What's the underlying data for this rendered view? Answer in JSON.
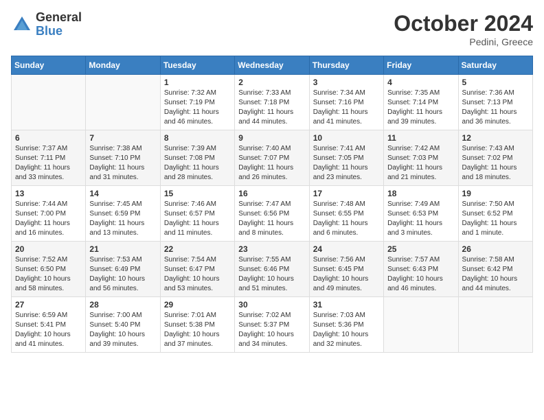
{
  "header": {
    "logo_general": "General",
    "logo_blue": "Blue",
    "month": "October 2024",
    "location": "Pedini, Greece"
  },
  "days_of_week": [
    "Sunday",
    "Monday",
    "Tuesday",
    "Wednesday",
    "Thursday",
    "Friday",
    "Saturday"
  ],
  "weeks": [
    [
      {
        "day": "",
        "info": ""
      },
      {
        "day": "",
        "info": ""
      },
      {
        "day": "1",
        "info": "Sunrise: 7:32 AM\nSunset: 7:19 PM\nDaylight: 11 hours and 46 minutes."
      },
      {
        "day": "2",
        "info": "Sunrise: 7:33 AM\nSunset: 7:18 PM\nDaylight: 11 hours and 44 minutes."
      },
      {
        "day": "3",
        "info": "Sunrise: 7:34 AM\nSunset: 7:16 PM\nDaylight: 11 hours and 41 minutes."
      },
      {
        "day": "4",
        "info": "Sunrise: 7:35 AM\nSunset: 7:14 PM\nDaylight: 11 hours and 39 minutes."
      },
      {
        "day": "5",
        "info": "Sunrise: 7:36 AM\nSunset: 7:13 PM\nDaylight: 11 hours and 36 minutes."
      }
    ],
    [
      {
        "day": "6",
        "info": "Sunrise: 7:37 AM\nSunset: 7:11 PM\nDaylight: 11 hours and 33 minutes."
      },
      {
        "day": "7",
        "info": "Sunrise: 7:38 AM\nSunset: 7:10 PM\nDaylight: 11 hours and 31 minutes."
      },
      {
        "day": "8",
        "info": "Sunrise: 7:39 AM\nSunset: 7:08 PM\nDaylight: 11 hours and 28 minutes."
      },
      {
        "day": "9",
        "info": "Sunrise: 7:40 AM\nSunset: 7:07 PM\nDaylight: 11 hours and 26 minutes."
      },
      {
        "day": "10",
        "info": "Sunrise: 7:41 AM\nSunset: 7:05 PM\nDaylight: 11 hours and 23 minutes."
      },
      {
        "day": "11",
        "info": "Sunrise: 7:42 AM\nSunset: 7:03 PM\nDaylight: 11 hours and 21 minutes."
      },
      {
        "day": "12",
        "info": "Sunrise: 7:43 AM\nSunset: 7:02 PM\nDaylight: 11 hours and 18 minutes."
      }
    ],
    [
      {
        "day": "13",
        "info": "Sunrise: 7:44 AM\nSunset: 7:00 PM\nDaylight: 11 hours and 16 minutes."
      },
      {
        "day": "14",
        "info": "Sunrise: 7:45 AM\nSunset: 6:59 PM\nDaylight: 11 hours and 13 minutes."
      },
      {
        "day": "15",
        "info": "Sunrise: 7:46 AM\nSunset: 6:57 PM\nDaylight: 11 hours and 11 minutes."
      },
      {
        "day": "16",
        "info": "Sunrise: 7:47 AM\nSunset: 6:56 PM\nDaylight: 11 hours and 8 minutes."
      },
      {
        "day": "17",
        "info": "Sunrise: 7:48 AM\nSunset: 6:55 PM\nDaylight: 11 hours and 6 minutes."
      },
      {
        "day": "18",
        "info": "Sunrise: 7:49 AM\nSunset: 6:53 PM\nDaylight: 11 hours and 3 minutes."
      },
      {
        "day": "19",
        "info": "Sunrise: 7:50 AM\nSunset: 6:52 PM\nDaylight: 11 hours and 1 minute."
      }
    ],
    [
      {
        "day": "20",
        "info": "Sunrise: 7:52 AM\nSunset: 6:50 PM\nDaylight: 10 hours and 58 minutes."
      },
      {
        "day": "21",
        "info": "Sunrise: 7:53 AM\nSunset: 6:49 PM\nDaylight: 10 hours and 56 minutes."
      },
      {
        "day": "22",
        "info": "Sunrise: 7:54 AM\nSunset: 6:47 PM\nDaylight: 10 hours and 53 minutes."
      },
      {
        "day": "23",
        "info": "Sunrise: 7:55 AM\nSunset: 6:46 PM\nDaylight: 10 hours and 51 minutes."
      },
      {
        "day": "24",
        "info": "Sunrise: 7:56 AM\nSunset: 6:45 PM\nDaylight: 10 hours and 49 minutes."
      },
      {
        "day": "25",
        "info": "Sunrise: 7:57 AM\nSunset: 6:43 PM\nDaylight: 10 hours and 46 minutes."
      },
      {
        "day": "26",
        "info": "Sunrise: 7:58 AM\nSunset: 6:42 PM\nDaylight: 10 hours and 44 minutes."
      }
    ],
    [
      {
        "day": "27",
        "info": "Sunrise: 6:59 AM\nSunset: 5:41 PM\nDaylight: 10 hours and 41 minutes."
      },
      {
        "day": "28",
        "info": "Sunrise: 7:00 AM\nSunset: 5:40 PM\nDaylight: 10 hours and 39 minutes."
      },
      {
        "day": "29",
        "info": "Sunrise: 7:01 AM\nSunset: 5:38 PM\nDaylight: 10 hours and 37 minutes."
      },
      {
        "day": "30",
        "info": "Sunrise: 7:02 AM\nSunset: 5:37 PM\nDaylight: 10 hours and 34 minutes."
      },
      {
        "day": "31",
        "info": "Sunrise: 7:03 AM\nSunset: 5:36 PM\nDaylight: 10 hours and 32 minutes."
      },
      {
        "day": "",
        "info": ""
      },
      {
        "day": "",
        "info": ""
      }
    ]
  ]
}
